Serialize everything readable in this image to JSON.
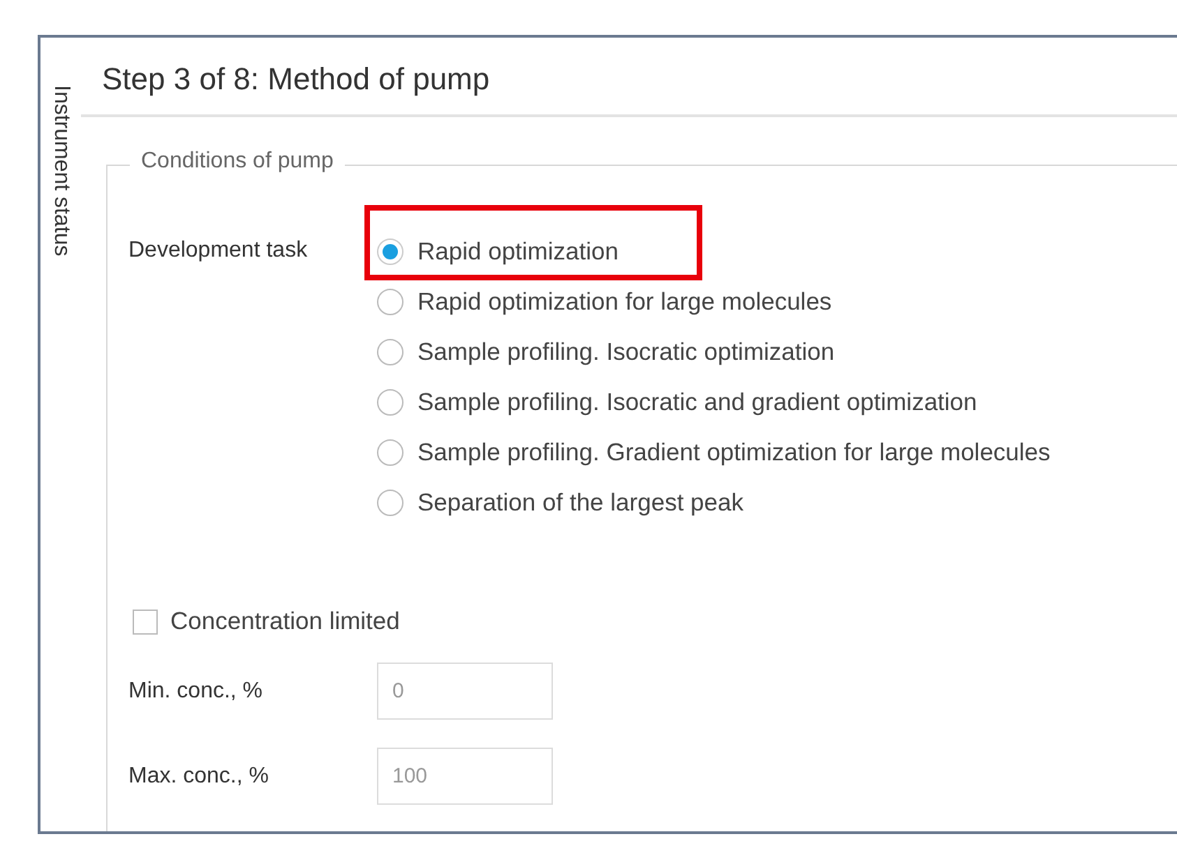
{
  "sidebar_tab": {
    "label": "Instrument status"
  },
  "title": "Step 3 of 8: Method of pump",
  "group": {
    "legend": "Conditions of pump",
    "development_task": {
      "label": "Development task",
      "options": [
        {
          "label": "Rapid optimization",
          "selected": true,
          "highlighted": true
        },
        {
          "label": "Rapid optimization for large molecules",
          "selected": false,
          "highlighted": false
        },
        {
          "label": "Sample profiling. Isocratic optimization",
          "selected": false,
          "highlighted": false
        },
        {
          "label": "Sample profiling. Isocratic and gradient optimization",
          "selected": false,
          "highlighted": false
        },
        {
          "label": "Sample profiling. Gradient optimization for large molecules",
          "selected": false,
          "highlighted": false
        },
        {
          "label": "Separation of the largest peak",
          "selected": false,
          "highlighted": false
        }
      ]
    },
    "concentration_limited": {
      "label": "Concentration limited",
      "checked": false
    },
    "fields": [
      {
        "label": "Min. conc., %",
        "value": "0",
        "disabled": true
      },
      {
        "label": "Max. conc., %",
        "value": "100",
        "disabled": true
      }
    ]
  }
}
